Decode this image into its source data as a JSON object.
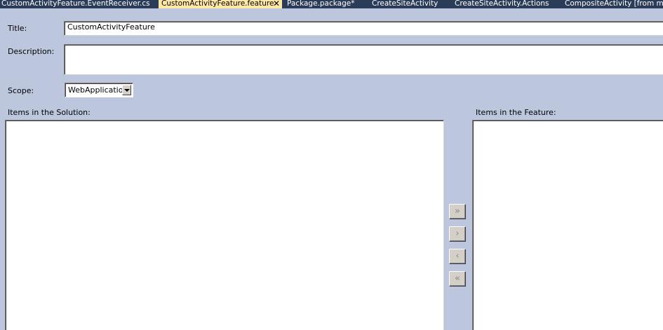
{
  "tabs": [
    {
      "label": "CustomActivityFeature.EventReceiver.cs",
      "active": false
    },
    {
      "label": "CustomActivityFeature.feature",
      "active": true,
      "close_glyph": "✕"
    },
    {
      "label": "Package.package*",
      "active": false
    },
    {
      "label": "CreateSiteActivity",
      "active": false
    },
    {
      "label": "CreateSiteActivity.Actions",
      "active": false
    },
    {
      "label": "CompositeActivity [from metadata]",
      "active": false
    }
  ],
  "form": {
    "title_label": "Title:",
    "title_value": "CustomActivityFeature",
    "description_label": "Description:",
    "description_value": "",
    "scope_label": "Scope:",
    "scope_value": "WebApplication"
  },
  "solution_items": {
    "label": "Items in the Solution:",
    "items": []
  },
  "feature_items": {
    "label": "Items in the Feature:",
    "items": []
  },
  "move_buttons": {
    "add_all": "»",
    "add": "›",
    "remove": "‹",
    "remove_all": "«"
  },
  "colors": {
    "background": "#bcc7dd",
    "tabstrip": "#2b3c59",
    "active_tab": "#ffe8a6"
  }
}
